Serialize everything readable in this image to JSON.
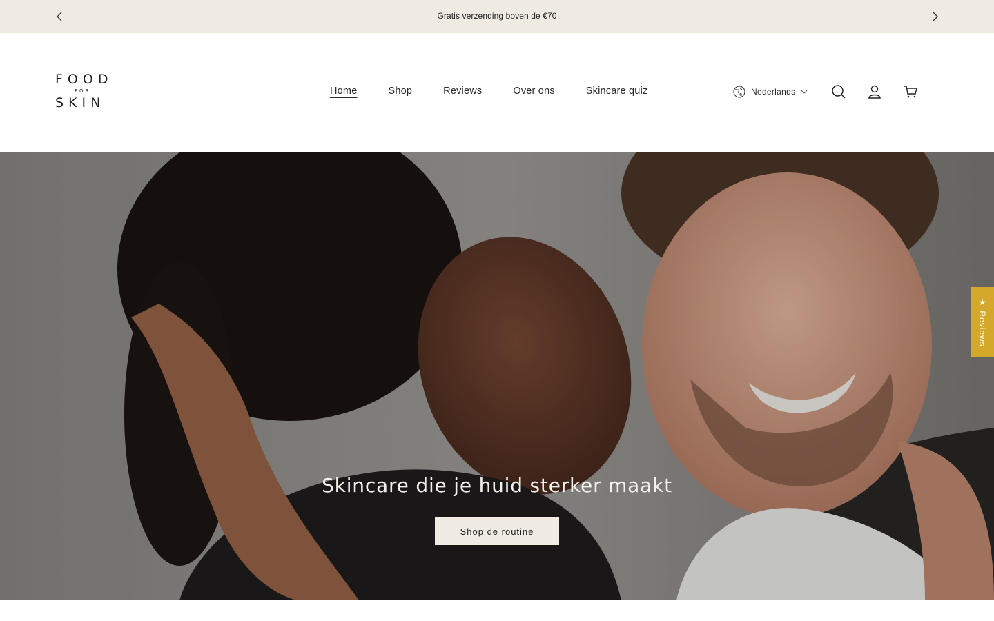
{
  "announcement": {
    "text": "Gratis verzending boven de €70",
    "prev_icon": "chevron-left-icon",
    "next_icon": "chevron-right-icon"
  },
  "header": {
    "logo": {
      "line1": "FOOD",
      "line2": "FOR",
      "line3": "SKIN"
    },
    "nav": [
      {
        "label": "Home",
        "active": true
      },
      {
        "label": "Shop"
      },
      {
        "label": "Reviews"
      },
      {
        "label": "Over ons"
      },
      {
        "label": "Skincare quiz"
      }
    ],
    "language": {
      "label": "Nederlands",
      "icon": "globe-icon"
    },
    "icons": [
      "search-icon",
      "account-icon",
      "cart-icon"
    ]
  },
  "hero": {
    "headline": "Skincare die je huid sterker maakt",
    "cta_label": "Shop de routine"
  },
  "reviews_tab": {
    "label": "★ Reviews",
    "color": "#d4a82a"
  },
  "colors": {
    "announcement_bg": "#efebe2",
    "cta_bg": "#f0ece4",
    "text": "#1c1c1c"
  }
}
